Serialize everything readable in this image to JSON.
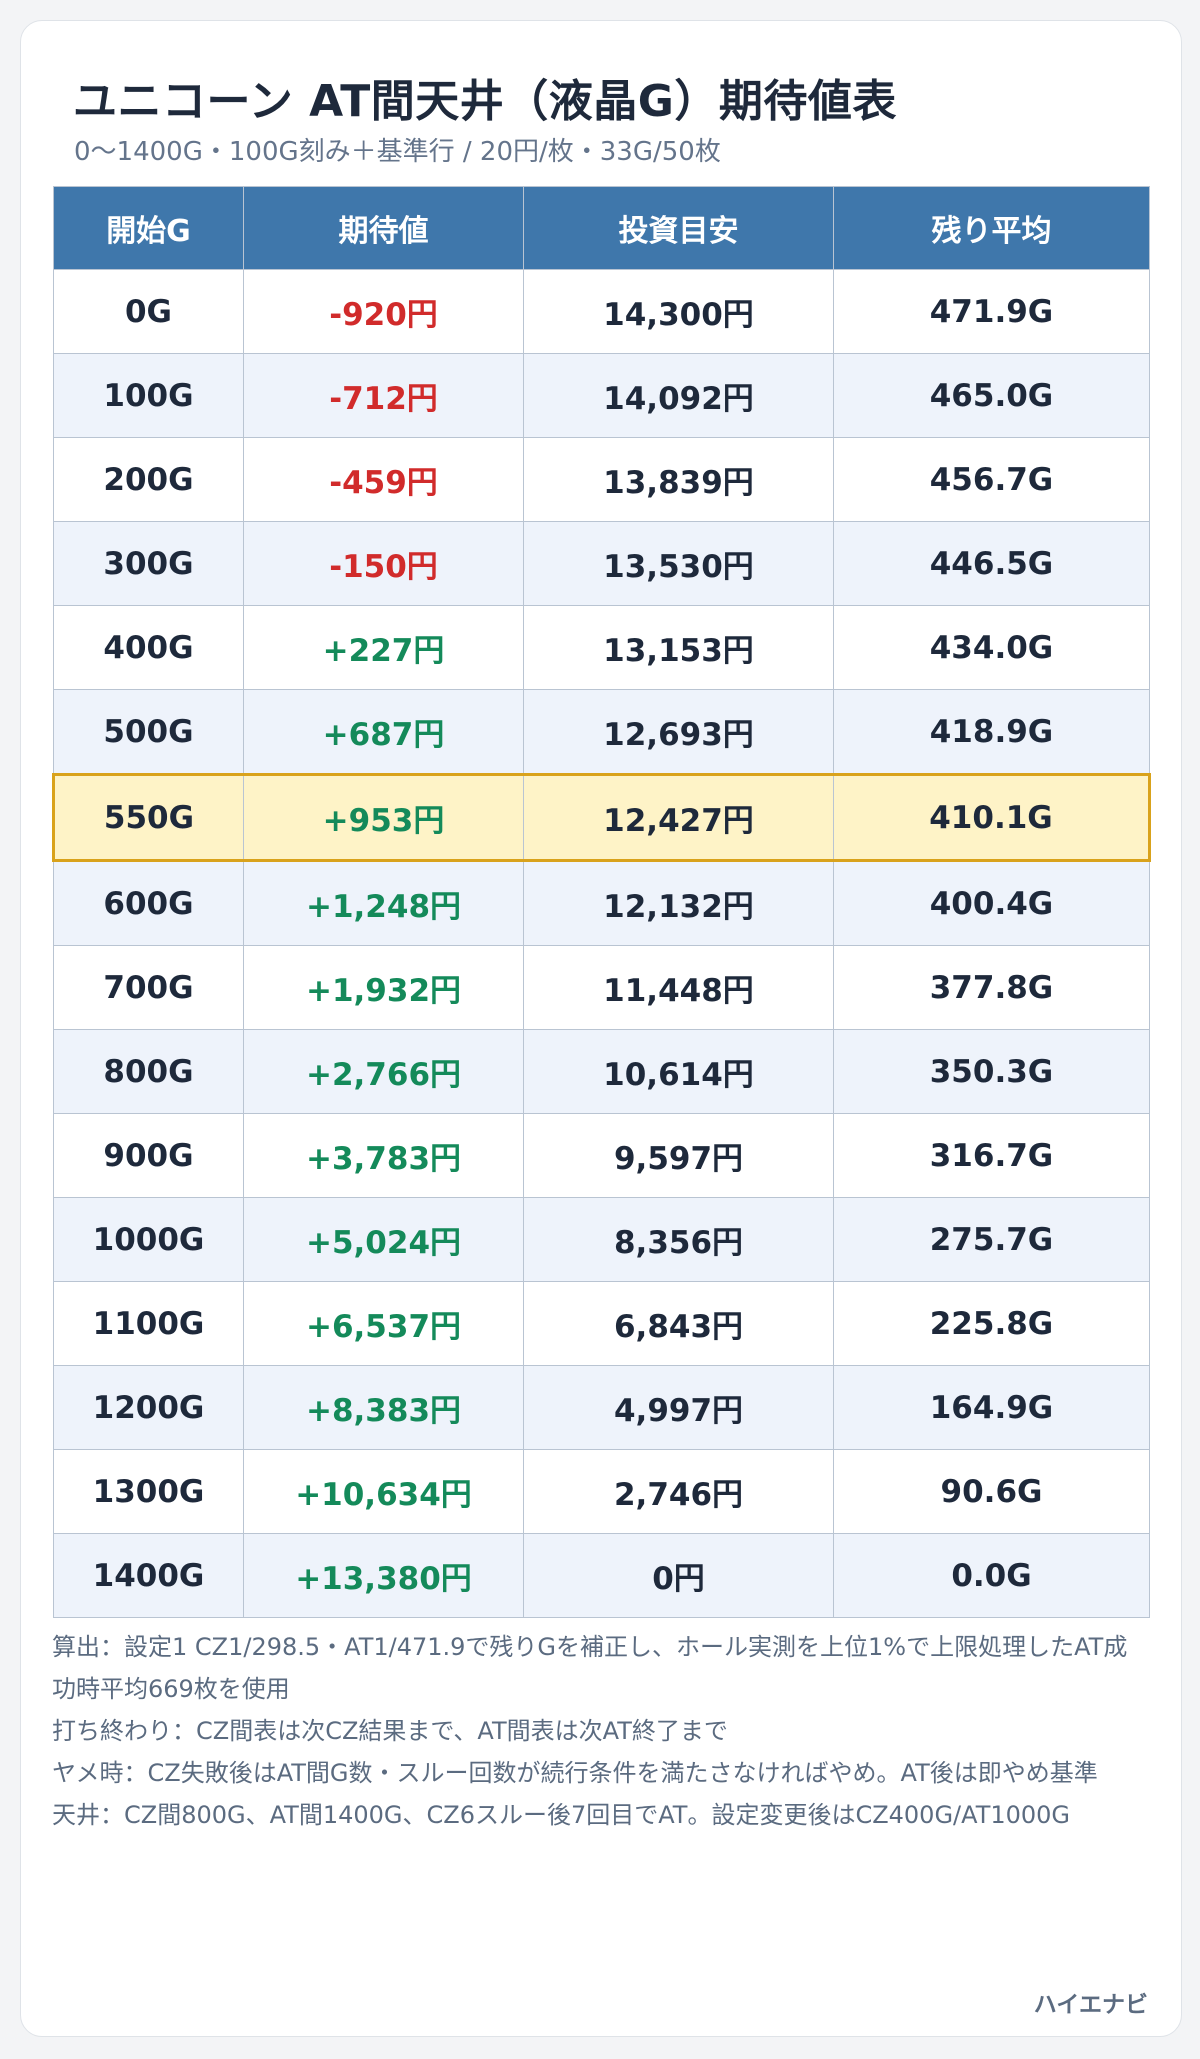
{
  "header": {
    "title": "ユニコーン AT間天井（液晶G）期待値表",
    "subtitle": "0〜1400G・100G刻み＋基準行 / 20円/枚・33G/50枚"
  },
  "table": {
    "columns": [
      "開始G",
      "期待値",
      "投資目安",
      "残り平均"
    ],
    "highlight_row": 6,
    "rows": [
      {
        "start": "0G",
        "ev": "-920円",
        "ev_sign": "neg",
        "invest": "14,300円",
        "remain": "471.9G"
      },
      {
        "start": "100G",
        "ev": "-712円",
        "ev_sign": "neg",
        "invest": "14,092円",
        "remain": "465.0G"
      },
      {
        "start": "200G",
        "ev": "-459円",
        "ev_sign": "neg",
        "invest": "13,839円",
        "remain": "456.7G"
      },
      {
        "start": "300G",
        "ev": "-150円",
        "ev_sign": "neg",
        "invest": "13,530円",
        "remain": "446.5G"
      },
      {
        "start": "400G",
        "ev": "+227円",
        "ev_sign": "pos",
        "invest": "13,153円",
        "remain": "434.0G"
      },
      {
        "start": "500G",
        "ev": "+687円",
        "ev_sign": "pos",
        "invest": "12,693円",
        "remain": "418.9G"
      },
      {
        "start": "550G",
        "ev": "+953円",
        "ev_sign": "pos",
        "invest": "12,427円",
        "remain": "410.1G"
      },
      {
        "start": "600G",
        "ev": "+1,248円",
        "ev_sign": "pos",
        "invest": "12,132円",
        "remain": "400.4G"
      },
      {
        "start": "700G",
        "ev": "+1,932円",
        "ev_sign": "pos",
        "invest": "11,448円",
        "remain": "377.8G"
      },
      {
        "start": "800G",
        "ev": "+2,766円",
        "ev_sign": "pos",
        "invest": "10,614円",
        "remain": "350.3G"
      },
      {
        "start": "900G",
        "ev": "+3,783円",
        "ev_sign": "pos",
        "invest": "9,597円",
        "remain": "316.7G"
      },
      {
        "start": "1000G",
        "ev": "+5,024円",
        "ev_sign": "pos",
        "invest": "8,356円",
        "remain": "275.7G"
      },
      {
        "start": "1100G",
        "ev": "+6,537円",
        "ev_sign": "pos",
        "invest": "6,843円",
        "remain": "225.8G"
      },
      {
        "start": "1200G",
        "ev": "+8,383円",
        "ev_sign": "pos",
        "invest": "4,997円",
        "remain": "164.9G"
      },
      {
        "start": "1300G",
        "ev": "+10,634円",
        "ev_sign": "pos",
        "invest": "2,746円",
        "remain": "90.6G"
      },
      {
        "start": "1400G",
        "ev": "+13,380円",
        "ev_sign": "pos",
        "invest": "0円",
        "remain": "0.0G"
      }
    ]
  },
  "notes": [
    "算出：設定1 CZ1/298.5・AT1/471.9で残りGを補正し、ホール実測を上位1%で上限処理したAT成功時平均669枚を使用",
    "打ち終わり：CZ間表は次CZ結果まで、AT間表は次AT終了まで",
    "ヤメ時：CZ失敗後はAT間G数・スルー回数が続行条件を満たさなければやめ。AT後は即やめ基準",
    "天井：CZ間800G、AT間1400G、CZ6スルー後7回目でAT。設定変更後はCZ400G/AT1000G"
  ],
  "footer": {
    "brand": "ハイエナビ"
  },
  "colors": {
    "header_bg": "#3f77ab",
    "negative": "#d12b2b",
    "positive": "#148a5a",
    "highlight_bg": "#fef3c7",
    "highlight_border": "#d9a21b"
  }
}
